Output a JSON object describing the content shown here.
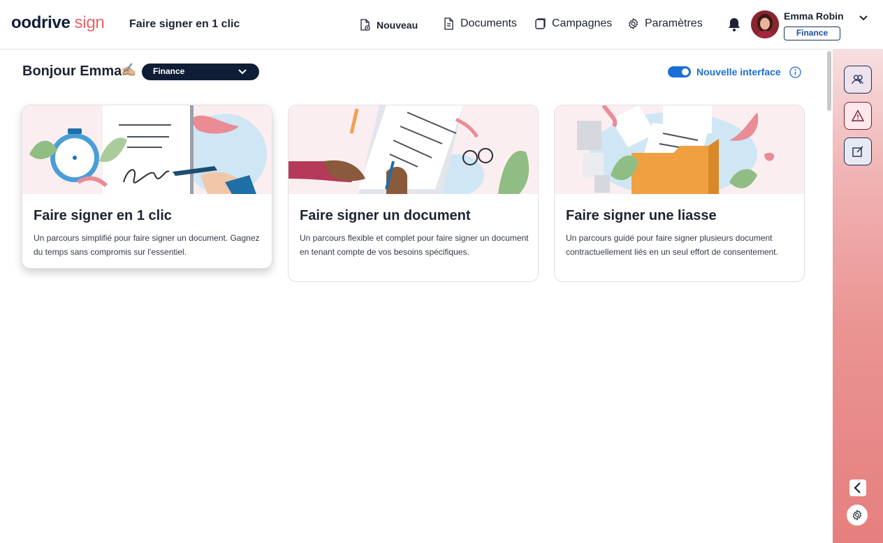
{
  "logo": {
    "part1": "oodrive",
    "part2": "sign"
  },
  "header": {
    "title": "Faire signer en 1 clic",
    "nav": {
      "new": "Nouveau",
      "documents": "Documents",
      "campaigns": "Campagnes",
      "settings": "Paramètres"
    },
    "user": {
      "name": "Emma Robin",
      "team": "Finance"
    }
  },
  "greeting": {
    "text": "Bonjour Emma",
    "emoji": "✍🏼"
  },
  "team_select": {
    "value": "Finance"
  },
  "toggle": {
    "label": "Nouvelle interface",
    "on": true
  },
  "cards": [
    {
      "title": "Faire signer en 1 clic",
      "desc": "Un parcours simplifié pour faire signer un document. Gagnez du temps sans compromis sur l'essentiel."
    },
    {
      "title": "Faire signer un document",
      "desc": "Un parcours flexible et complet pour faire signer un document en tenant compte de vos besoins spécifiques."
    },
    {
      "title": "Faire signer une liasse",
      "desc": "Un parcours guidé pour faire signer plusieurs document contractuellement liés en un seul effort de consentement."
    }
  ],
  "colors": {
    "brand_dark": "#0f1d36",
    "brand_accent": "#e8636a",
    "link": "#1a6fd6",
    "rail": "#e88d8c"
  },
  "icons": [
    "new-doc-icon",
    "document-icon",
    "campaign-icon",
    "gear-icon",
    "bell-icon",
    "chevron-down-icon",
    "info-icon",
    "team-icon",
    "warning-icon",
    "edit-icon",
    "chevron-left-icon"
  ]
}
